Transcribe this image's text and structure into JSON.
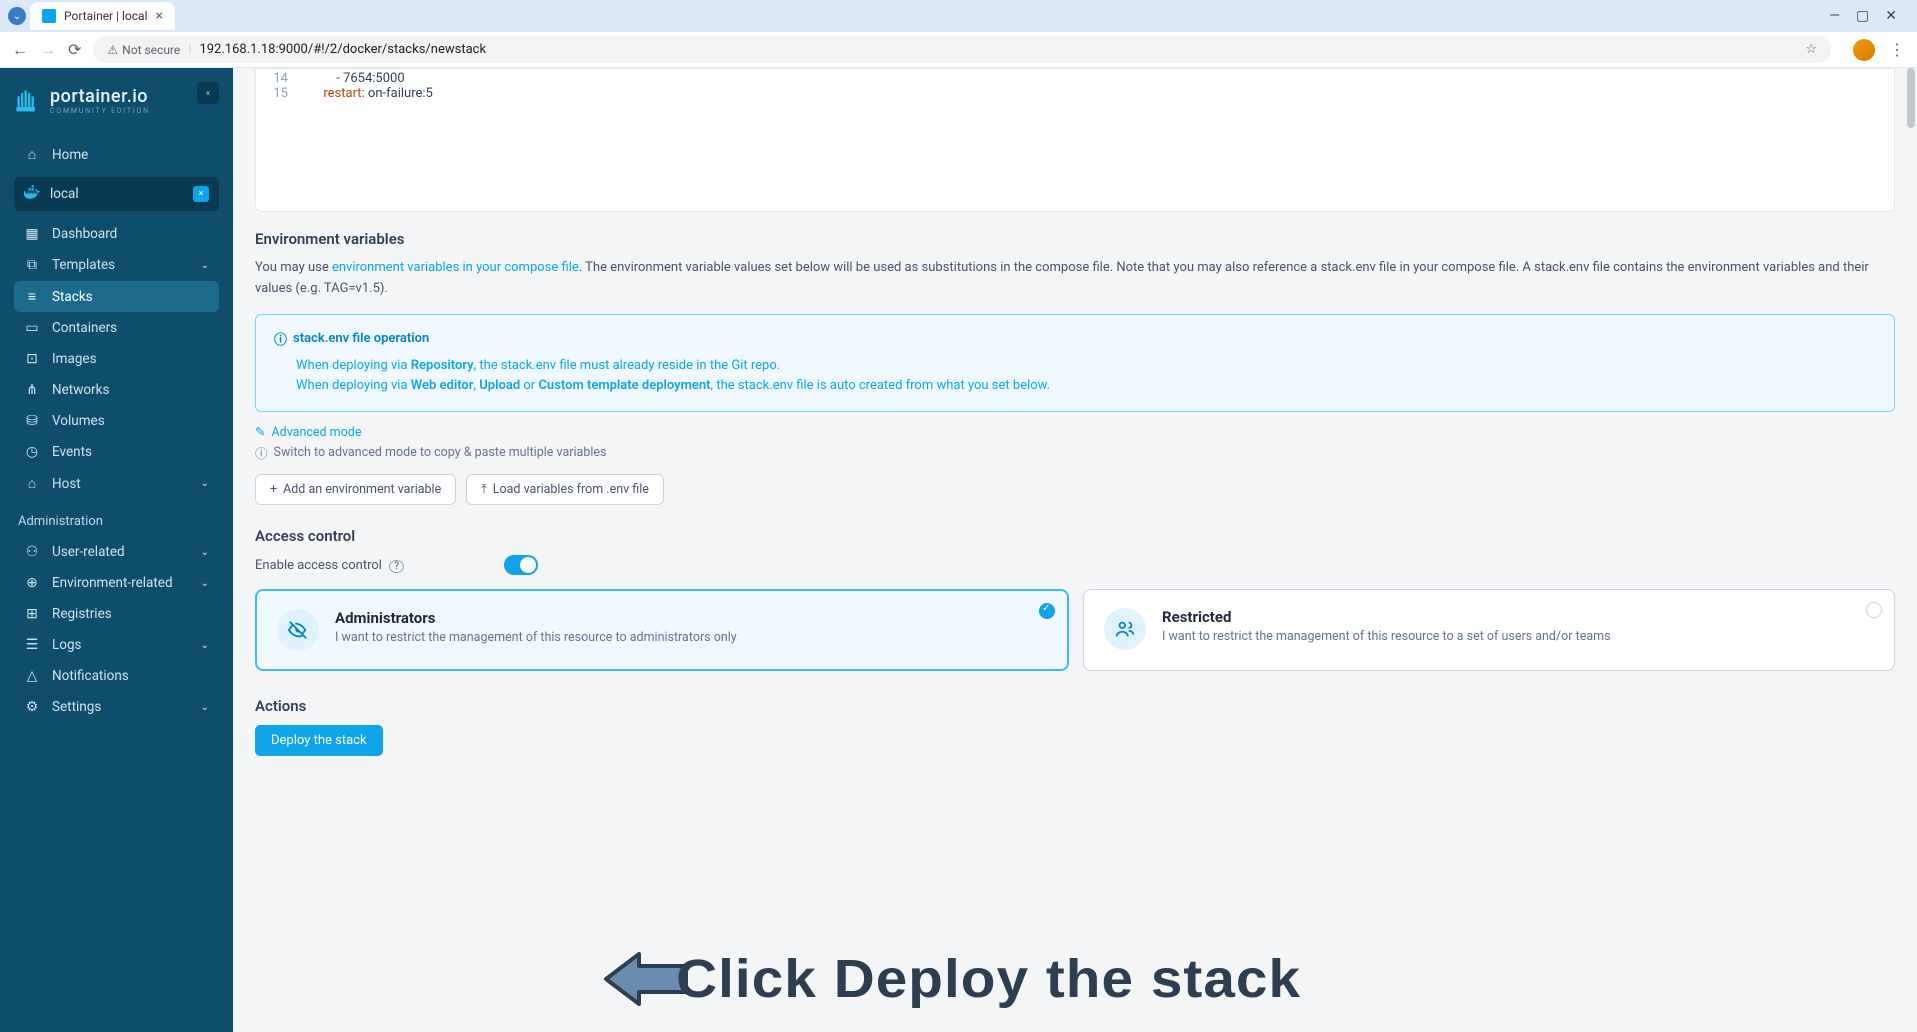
{
  "browser": {
    "tab_title": "Portainer | local",
    "security_label": "Not secure",
    "url": "192.168.1.18:9000/#!/2/docker/stacks/newstack"
  },
  "logo": {
    "name": "portainer.io",
    "edition": "COMMUNITY EDITION"
  },
  "sidebar": {
    "home": "Home",
    "env_name": "local",
    "items": [
      "Dashboard",
      "Templates",
      "Stacks",
      "Containers",
      "Images",
      "Networks",
      "Volumes",
      "Events",
      "Host"
    ],
    "admin_label": "Administration",
    "admin_items": [
      "User-related",
      "Environment-related",
      "Registries",
      "Logs",
      "Notifications",
      "Settings"
    ]
  },
  "editor": {
    "lines": [
      {
        "n": 14,
        "indent": "          ",
        "plain": "- 7654:5000"
      },
      {
        "n": 15,
        "indent": "      ",
        "kw": "restart:",
        "plain": " on-failure:5"
      }
    ]
  },
  "env_section": {
    "title": "Environment variables",
    "desc_prefix": "You may use ",
    "desc_link": "environment variables in your compose file",
    "desc_suffix": ". The environment variable values set below will be used as substitutions in the compose file. Note that you may also reference a stack.env file in your compose file. A stack.env file contains the environment variables and their values (e.g. TAG=v1.5).",
    "info_title": "stack.env file operation",
    "info_line1_a": "When deploying via ",
    "info_line1_b": "Repository",
    "info_line1_c": ", the stack.env file must already reside in the Git repo.",
    "info_line2_a": "When deploying via ",
    "info_line2_b": "Web editor",
    "info_line2_c": ", ",
    "info_line2_d": "Upload",
    "info_line2_e": " or ",
    "info_line2_f": "Custom template deployment",
    "info_line2_g": ", the stack.env file is auto created from what you set below.",
    "adv_mode": "Advanced mode",
    "adv_hint": "Switch to advanced mode to copy & paste multiple variables",
    "btn_add": "Add an environment variable",
    "btn_load": "Load variables from .env file"
  },
  "access": {
    "title": "Access control",
    "toggle_label": "Enable access control",
    "admin_title": "Administrators",
    "admin_desc": "I want to restrict the management of this resource to administrators only",
    "restricted_title": "Restricted",
    "restricted_desc": "I want to restrict the management of this resource to a set of users and/or teams"
  },
  "actions": {
    "title": "Actions",
    "deploy": "Deploy the stack"
  },
  "annotation": "Click Deploy the stack"
}
